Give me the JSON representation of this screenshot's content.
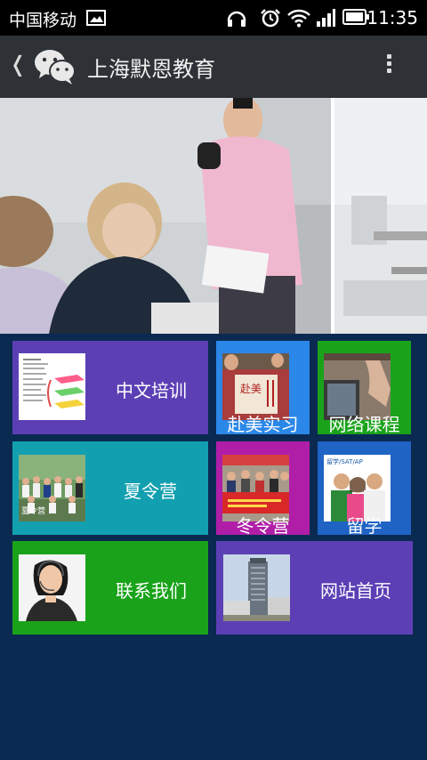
{
  "status_bar": {
    "carrier": "中国移动",
    "time": "11:35",
    "icons": [
      "image-icon",
      "headphones-icon",
      "alarm-icon",
      "wifi-icon",
      "signal-icon",
      "battery-icon"
    ]
  },
  "top_bar": {
    "title": "上海默恩教育",
    "back_icon": "back-chevron-icon",
    "app_icon": "wechat-icon",
    "menu_icon": "more-vert-icon"
  },
  "banner": {
    "slide_count": 2,
    "active_slide": 2
  },
  "tiles": [
    {
      "label": "中文培训",
      "color": "#5c3fb5"
    },
    {
      "label": "赴美实习",
      "color": "#2b87e8",
      "thumb_text": "赴美"
    },
    {
      "label": "网络课程",
      "color": "#1aa31a"
    },
    {
      "label": "夏令营",
      "color": "#12a0b0",
      "thumb_text": "夏令营"
    },
    {
      "label": "冬令营",
      "color": "#b01ea8"
    },
    {
      "label": "留学",
      "color": "#1f63c4",
      "thumb_text": "留学/SAT/AP"
    },
    {
      "label": "联系我们",
      "color": "#1aa31a"
    },
    {
      "label": "网站首页",
      "color": "#5c3fb5"
    }
  ],
  "colors": {
    "page_background": "#0b2a52",
    "status_bar": "#000000",
    "top_bar": "#2e3236"
  }
}
